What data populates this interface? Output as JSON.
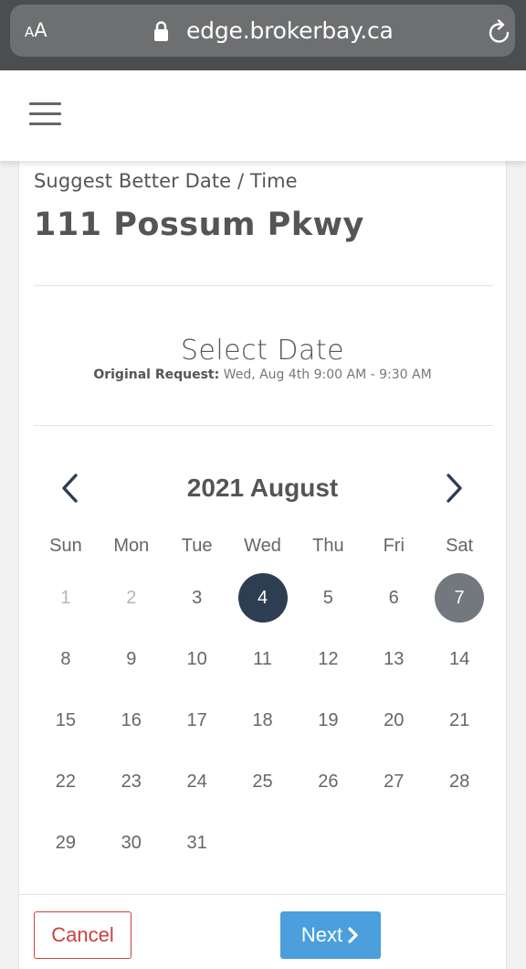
{
  "browser": {
    "aa_small": "A",
    "aa_big": "A",
    "url": "edge.brokerbay.ca"
  },
  "page": {
    "subtitle": "Suggest Better Date / Time",
    "address": "111 Possum Pkwy",
    "select_title": "Select Date",
    "original_label": "Original Request:",
    "original_value": " Wed, Aug 4th 9:00 AM - 9:30 AM"
  },
  "calendar": {
    "month_title": "2021 August",
    "weekdays": [
      "Sun",
      "Mon",
      "Tue",
      "Wed",
      "Thu",
      "Fri",
      "Sat"
    ],
    "weeks": [
      [
        "1",
        "2",
        "3",
        "4",
        "5",
        "6",
        "7"
      ],
      [
        "8",
        "9",
        "10",
        "11",
        "12",
        "13",
        "14"
      ],
      [
        "15",
        "16",
        "17",
        "18",
        "19",
        "20",
        "21"
      ],
      [
        "22",
        "23",
        "24",
        "25",
        "26",
        "27",
        "28"
      ],
      [
        "29",
        "30",
        "31",
        "",
        "",
        "",
        ""
      ]
    ],
    "muted_days": [
      "1",
      "2"
    ],
    "selected_day": "4",
    "highlighted_day": "7"
  },
  "footer": {
    "cancel_label": "Cancel",
    "next_label": "Next"
  },
  "colors": {
    "selected": "#2e3e52",
    "highlighted": "#72787e",
    "cancel": "#c9423a",
    "next": "#4b9fdd"
  }
}
